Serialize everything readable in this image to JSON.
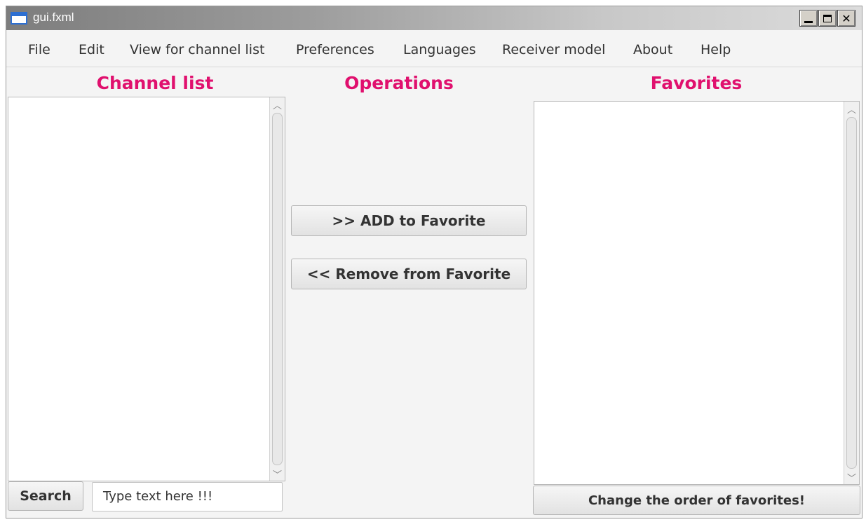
{
  "window": {
    "title": "gui.fxml",
    "minimize_icon": "minimize-icon",
    "maximize_icon": "maximize-icon",
    "close_label": "✕"
  },
  "menu": {
    "items": [
      "File",
      "Edit",
      "View for channel list",
      "Preferences",
      "Languages",
      "Receiver model",
      "About",
      "Help"
    ]
  },
  "sections": {
    "channel_list": "Channel list",
    "operations": "Operations",
    "favorites": "Favorites"
  },
  "buttons": {
    "add": ">> ADD to Favorite",
    "remove": "<< Remove from Favorite",
    "search": "Search",
    "change_order": "Change the order of favorites!"
  },
  "search": {
    "value": "Type text here !!!"
  },
  "colors": {
    "section_title": "#e0106e"
  }
}
